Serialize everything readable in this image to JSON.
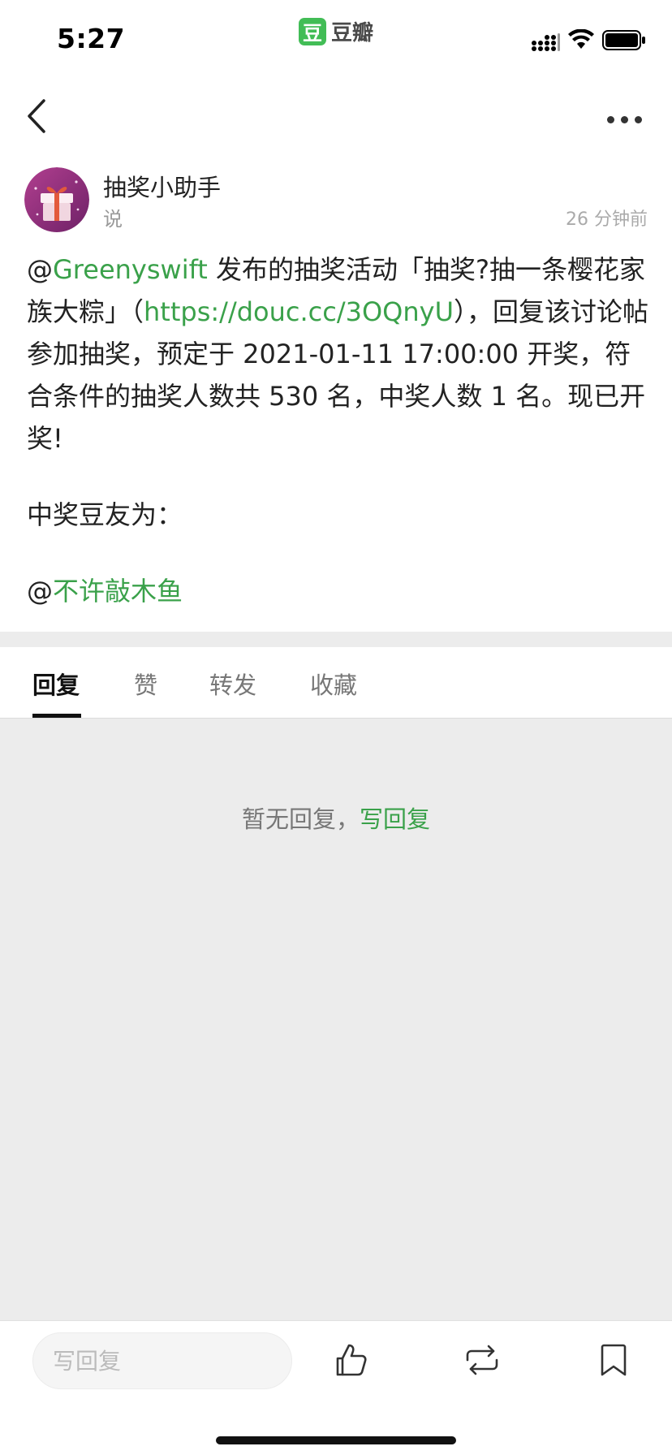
{
  "status_bar": {
    "time": "5:27",
    "brand_logo_char": "豆",
    "brand_name": "豆瓣"
  },
  "nav": {
    "back_icon": "chevron-left-icon",
    "more_icon": "more-horizontal-icon"
  },
  "post": {
    "author": "抽奖小助手",
    "verb": "说",
    "time_ago": "26 分钟前",
    "body": {
      "at1": "@",
      "mention1": "Greenyswift",
      "text1": " 发布的抽奖活动「抽奖?抽一条樱花家族大粽」（",
      "url": "https://douc.cc/3OQnyU",
      "text2": "），回复该讨论帖参加抽奖，预定于 2021-01-11 17:00:00 开奖，符合条件的抽奖人数共 530 名，中奖人数 1 名。现已开奖!",
      "winner_label": "中奖豆友为：",
      "at2": "@",
      "winner": "不许敲木鱼"
    }
  },
  "tabs": [
    {
      "label": "回复",
      "active": true
    },
    {
      "label": "赞",
      "active": false
    },
    {
      "label": "转发",
      "active": false
    },
    {
      "label": "收藏",
      "active": false
    }
  ],
  "empty": {
    "text": "暂无回复，",
    "link": "写回复"
  },
  "bottom_bar": {
    "reply_placeholder": "写回复",
    "icons": [
      "thumbs-up-icon",
      "repost-icon",
      "bookmark-icon"
    ]
  },
  "colors": {
    "accent": "#3aa14a",
    "brand": "#42bd56",
    "background": "#ececec"
  }
}
